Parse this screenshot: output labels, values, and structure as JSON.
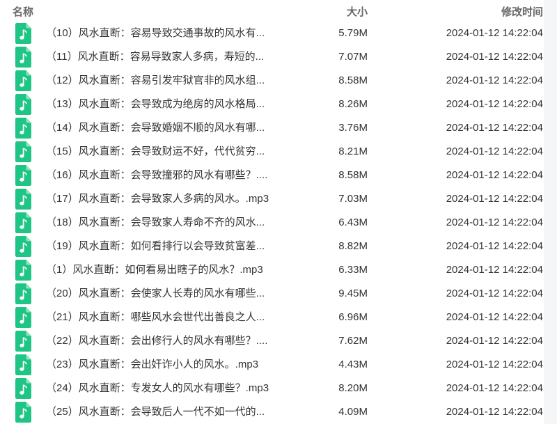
{
  "header": {
    "name_label": "名称",
    "size_label": "大小",
    "modified_label": "修改时间"
  },
  "files": [
    {
      "name": "（10）风水直断：容易导致交通事故的风水有...",
      "size": "5.79M",
      "modified": "2024-01-12 14:22:04"
    },
    {
      "name": "（11）风水直断：容易导致家人多病，寿短的...",
      "size": "7.07M",
      "modified": "2024-01-12 14:22:04"
    },
    {
      "name": "（12）风水直断：容易引发牢狱官非的风水组...",
      "size": "8.58M",
      "modified": "2024-01-12 14:22:04"
    },
    {
      "name": "（13）风水直断：会导致成为绝房的风水格局...",
      "size": "8.26M",
      "modified": "2024-01-12 14:22:04"
    },
    {
      "name": "（14）风水直断：会导致婚姻不顺的风水有哪...",
      "size": "3.76M",
      "modified": "2024-01-12 14:22:04"
    },
    {
      "name": "（15）风水直断：会导致财运不好，代代贫穷...",
      "size": "8.21M",
      "modified": "2024-01-12 14:22:04"
    },
    {
      "name": "（16）风水直断：会导致撞邪的风水有哪些？....",
      "size": "8.58M",
      "modified": "2024-01-12 14:22:04"
    },
    {
      "name": "（17）风水直断：会导致家人多病的风水。.mp3",
      "size": "7.03M",
      "modified": "2024-01-12 14:22:04"
    },
    {
      "name": "（18）风水直断：会导致家人寿命不齐的风水...",
      "size": "6.43M",
      "modified": "2024-01-12 14:22:04"
    },
    {
      "name": "（19）风水直断：如何看排行以会导致贫富差...",
      "size": "8.82M",
      "modified": "2024-01-12 14:22:04"
    },
    {
      "name": "（1）风水直断：如何看易出瞎子的风水？.mp3",
      "size": "6.33M",
      "modified": "2024-01-12 14:22:04"
    },
    {
      "name": "（20）风水直断：会使家人长寿的风水有哪些...",
      "size": "9.45M",
      "modified": "2024-01-12 14:22:04"
    },
    {
      "name": "（21）风水直断：哪些风水会世代出善良之人...",
      "size": "6.96M",
      "modified": "2024-01-12 14:22:04"
    },
    {
      "name": "（22）风水直断：会出修行人的风水有哪些？....",
      "size": "7.62M",
      "modified": "2024-01-12 14:22:04"
    },
    {
      "name": "（23）风水直断：会出奸诈小人的风水。.mp3",
      "size": "4.43M",
      "modified": "2024-01-12 14:22:04"
    },
    {
      "name": "（24）风水直断：专发女人的风水有哪些？.mp3",
      "size": "8.20M",
      "modified": "2024-01-12 14:22:04"
    },
    {
      "name": "（25）风水直断：会导致后人一代不如一代的...",
      "size": "4.09M",
      "modified": "2024-01-12 14:22:04"
    }
  ],
  "icons": {
    "file": "audio-file-icon"
  },
  "colors": {
    "icon_fill": "#1ec584",
    "icon_fold": "#8be3bd",
    "text": "#333333",
    "header_text": "#666666",
    "side_background": "#f5f6f7"
  }
}
